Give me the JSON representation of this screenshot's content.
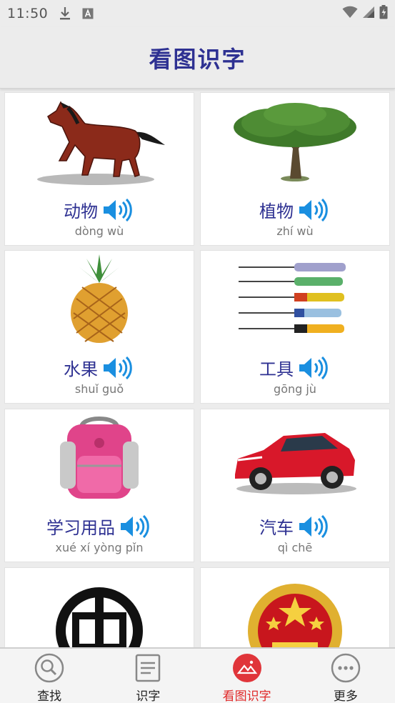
{
  "status_bar": {
    "time": "11:50"
  },
  "header": {
    "title": "看图识字"
  },
  "cards": [
    {
      "label": "动物",
      "pinyin": "dòng wù",
      "image_icon": "horse-image"
    },
    {
      "label": "植物",
      "pinyin": "zhí wù",
      "image_icon": "tree-image"
    },
    {
      "label": "水果",
      "pinyin": "shuǐ guǒ",
      "image_icon": "pineapple-image"
    },
    {
      "label": "工具",
      "pinyin": "gōng jù",
      "image_icon": "screwdrivers-image"
    },
    {
      "label": "学习用品",
      "pinyin": "xué xí yòng pǐn",
      "image_icon": "backpack-image"
    },
    {
      "label": "汽车",
      "pinyin": "qì chē",
      "image_icon": "car-image"
    }
  ],
  "nav": [
    {
      "label": "查找",
      "icon": "search-icon",
      "active": false
    },
    {
      "label": "识字",
      "icon": "document-icon",
      "active": false
    },
    {
      "label": "看图识字",
      "icon": "picture-icon",
      "active": true
    },
    {
      "label": "更多",
      "icon": "more-icon",
      "active": false
    }
  ],
  "colors": {
    "title": "#2e3192",
    "active_nav": "#e02a2a",
    "speaker": "#1a8fe0"
  }
}
